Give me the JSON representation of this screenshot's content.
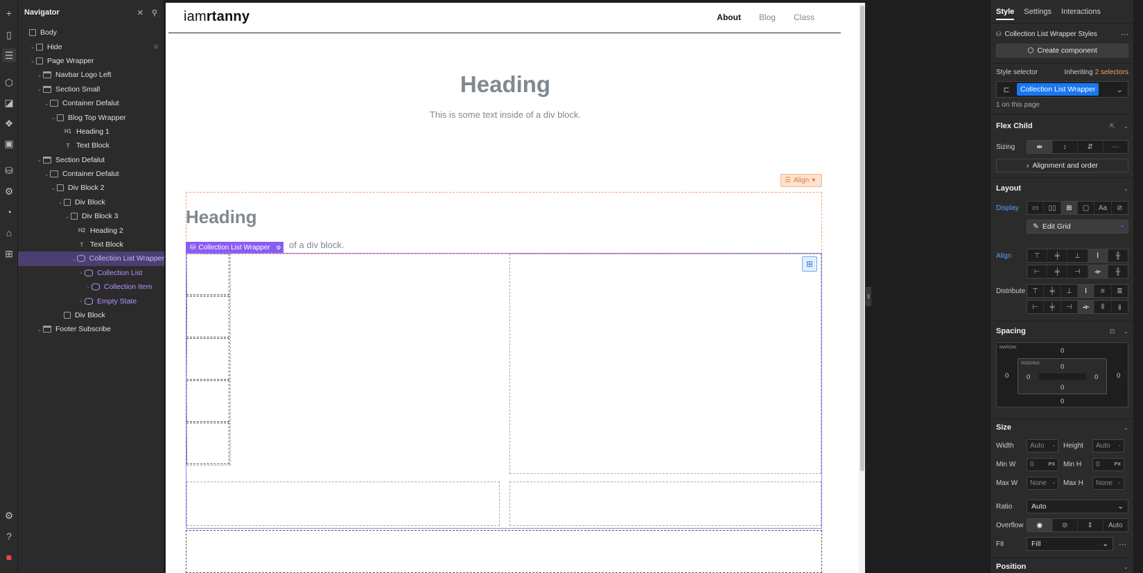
{
  "rail": {
    "icons": [
      "plus-icon",
      "pages-icon",
      "navigator-icon",
      "components-icon",
      "variables-icon",
      "styles-icon",
      "assets-icon",
      "cms-icon",
      "logic-icon",
      "users-icon",
      "ecommerce-icon",
      "apps-icon",
      "settings-icon",
      "help-icon",
      "stop-icon"
    ]
  },
  "navigator": {
    "title": "Navigator",
    "items": [
      {
        "label": "Body",
        "depth": 0,
        "icon": "box"
      },
      {
        "label": "Hide",
        "depth": 1,
        "icon": "box",
        "caret": true
      },
      {
        "label": "Page Wrapper",
        "depth": 1,
        "icon": "box",
        "caret": true
      },
      {
        "label": "Navbar Logo Left",
        "depth": 2,
        "icon": "section",
        "caret": true
      },
      {
        "label": "Section Small",
        "depth": 2,
        "icon": "section",
        "caret": true
      },
      {
        "label": "Container Defalut",
        "depth": 3,
        "icon": "container",
        "caret": true
      },
      {
        "label": "Blog Top Wrapper",
        "depth": 4,
        "icon": "box",
        "caret": true
      },
      {
        "label": "Heading 1",
        "depth": 5,
        "icon": "H1"
      },
      {
        "label": "Text Block",
        "depth": 5,
        "icon": "T"
      },
      {
        "label": "Section Defalut",
        "depth": 2,
        "icon": "section",
        "caret": true
      },
      {
        "label": "Container Defalut",
        "depth": 3,
        "icon": "container",
        "caret": true
      },
      {
        "label": "Div Block 2",
        "depth": 4,
        "icon": "box",
        "caret": true
      },
      {
        "label": "Div Block",
        "depth": 5,
        "icon": "box",
        "caret": true
      },
      {
        "label": "Div Block 3",
        "depth": 6,
        "icon": "box",
        "caret": true
      },
      {
        "label": "Heading 2",
        "depth": 7,
        "icon": "H2"
      },
      {
        "label": "Text Block",
        "depth": 7,
        "icon": "T"
      },
      {
        "label": "Collection List Wrapper",
        "depth": 7,
        "icon": "db",
        "caret": true,
        "selected": true
      },
      {
        "label": "Collection List",
        "depth": 8,
        "icon": "db",
        "caret": true,
        "purple": true
      },
      {
        "label": "Collection Item",
        "depth": 9,
        "icon": "db",
        "caret": true,
        "purple": true
      },
      {
        "label": "Empty State",
        "depth": 8,
        "icon": "db",
        "caret": true,
        "purple": true
      },
      {
        "label": "Div Block",
        "depth": 5,
        "icon": "box"
      },
      {
        "label": "Footer Subscribe",
        "depth": 2,
        "icon": "section",
        "caret": true
      }
    ]
  },
  "page": {
    "logo_light": "iam",
    "logo_bold": "rtanny",
    "nav": [
      "About",
      "Blog",
      "Class"
    ],
    "hero_heading": "Heading",
    "hero_text": "This is some text inside of a div block.",
    "align_label": "Align",
    "section_heading": "Heading",
    "section_text_visible": "of a div block.",
    "selected_tag": "Collection List Wrapper"
  },
  "panel": {
    "tabs": [
      "Style",
      "Settings",
      "Interactions"
    ],
    "styles_title": "Collection List Wrapper Styles",
    "create_component": "Create component",
    "style_selector_label": "Style selector",
    "inheriting_label": "Inheriting",
    "inheriting_count": "2 selectors",
    "selector_chip": "Collection List Wrapper",
    "on_page": "1 on this page",
    "flex_child": "Flex Child",
    "sizing_label": "Sizing",
    "alignment_order": "Alignment and order",
    "layout": "Layout",
    "display_label": "Display",
    "edit_grid": "Edit Grid",
    "align_label": "Align",
    "distribute_label": "Distribute",
    "spacing": "Spacing",
    "margin_label": "MARGIN",
    "padding_label": "PADDING",
    "margin": {
      "top": "0",
      "right": "0",
      "bottom": "0",
      "left": "0"
    },
    "padding": {
      "top": "0",
      "right": "0",
      "bottom": "0",
      "left": "0"
    },
    "size": "Size",
    "width_label": "Width",
    "width_val": "Auto",
    "height_label": "Height",
    "height_val": "Auto",
    "minw_label": "Min W",
    "minw_val": "0",
    "minw_unit": "PX",
    "minh_label": "Min H",
    "minh_val": "0",
    "minh_unit": "PX",
    "maxw_label": "Max W",
    "maxw_val": "None",
    "maxh_label": "Max H",
    "maxh_val": "None",
    "ratio_label": "Ratio",
    "ratio_val": "Auto",
    "overflow_label": "Overflow",
    "overflow_auto": "Auto",
    "fit_label": "Fit",
    "fit_val": "Fill",
    "position": "Position"
  },
  "colors": {
    "accent_purple": "#8a5cf5",
    "selector_blue": "#1877f2",
    "inherit_orange": "#f4a261",
    "align_orange": "#e07a2f"
  }
}
